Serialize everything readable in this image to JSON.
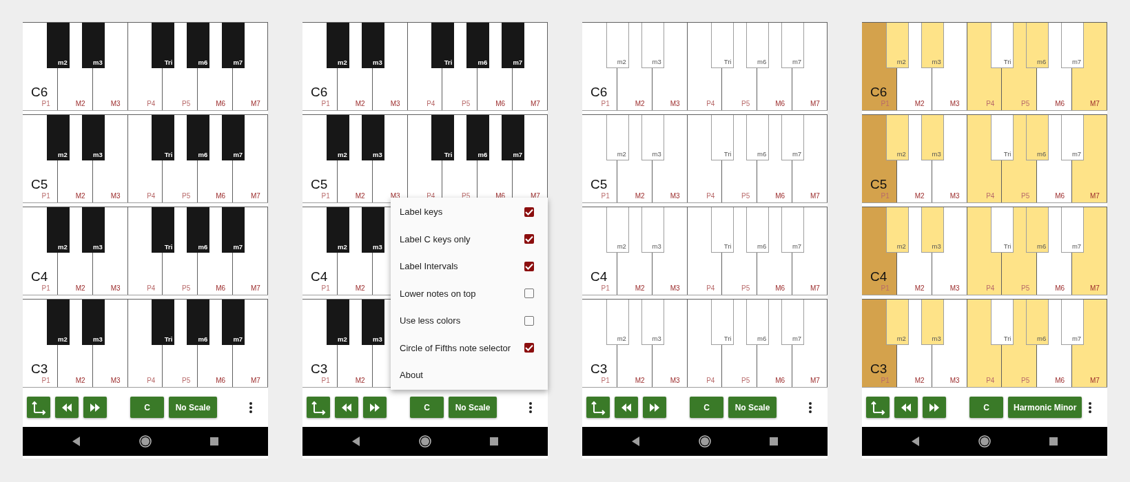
{
  "phones": [
    {
      "outlined_black_keys": false,
      "octaves": [
        {
          "label": "C6",
          "white_keys": [
            {
              "label": "P1",
              "kind": "perfect",
              "root": false,
              "in_scale": false
            },
            {
              "label": "M2",
              "kind": "major",
              "root": false,
              "in_scale": false
            },
            {
              "label": "M3",
              "kind": "major",
              "root": false,
              "in_scale": false
            },
            {
              "label": "P4",
              "kind": "perfect",
              "root": false,
              "in_scale": false
            },
            {
              "label": "P5",
              "kind": "perfect",
              "root": false,
              "in_scale": false
            },
            {
              "label": "M6",
              "kind": "major",
              "root": false,
              "in_scale": false
            },
            {
              "label": "M7",
              "kind": "major",
              "root": false,
              "in_scale": false
            }
          ],
          "black_keys": [
            {
              "label": "m2",
              "in_scale": false
            },
            {
              "label": "m3",
              "in_scale": false
            },
            {
              "label": "Tri",
              "in_scale": false
            },
            {
              "label": "m6",
              "in_scale": false
            },
            {
              "label": "m7",
              "in_scale": false
            }
          ]
        },
        {
          "label": "C5",
          "white_keys": [
            {
              "label": "P1",
              "kind": "perfect",
              "root": false,
              "in_scale": false
            },
            {
              "label": "M2",
              "kind": "major",
              "root": false,
              "in_scale": false
            },
            {
              "label": "M3",
              "kind": "major",
              "root": false,
              "in_scale": false
            },
            {
              "label": "P4",
              "kind": "perfect",
              "root": false,
              "in_scale": false
            },
            {
              "label": "P5",
              "kind": "perfect",
              "root": false,
              "in_scale": false
            },
            {
              "label": "M6",
              "kind": "major",
              "root": false,
              "in_scale": false
            },
            {
              "label": "M7",
              "kind": "major",
              "root": false,
              "in_scale": false
            }
          ],
          "black_keys": [
            {
              "label": "m2",
              "in_scale": false
            },
            {
              "label": "m3",
              "in_scale": false
            },
            {
              "label": "Tri",
              "in_scale": false
            },
            {
              "label": "m6",
              "in_scale": false
            },
            {
              "label": "m7",
              "in_scale": false
            }
          ]
        },
        {
          "label": "C4",
          "white_keys": [
            {
              "label": "P1",
              "kind": "perfect",
              "root": false,
              "in_scale": false
            },
            {
              "label": "M2",
              "kind": "major",
              "root": false,
              "in_scale": false
            },
            {
              "label": "M3",
              "kind": "major",
              "root": false,
              "in_scale": false
            },
            {
              "label": "P4",
              "kind": "perfect",
              "root": false,
              "in_scale": false
            },
            {
              "label": "P5",
              "kind": "perfect",
              "root": false,
              "in_scale": false
            },
            {
              "label": "M6",
              "kind": "major",
              "root": false,
              "in_scale": false
            },
            {
              "label": "M7",
              "kind": "major",
              "root": false,
              "in_scale": false
            }
          ],
          "black_keys": [
            {
              "label": "m2",
              "in_scale": false
            },
            {
              "label": "m3",
              "in_scale": false
            },
            {
              "label": "Tri",
              "in_scale": false
            },
            {
              "label": "m6",
              "in_scale": false
            },
            {
              "label": "m7",
              "in_scale": false
            }
          ]
        },
        {
          "label": "C3",
          "white_keys": [
            {
              "label": "P1",
              "kind": "perfect",
              "root": false,
              "in_scale": false
            },
            {
              "label": "M2",
              "kind": "major",
              "root": false,
              "in_scale": false
            },
            {
              "label": "M3",
              "kind": "major",
              "root": false,
              "in_scale": false
            },
            {
              "label": "P4",
              "kind": "perfect",
              "root": false,
              "in_scale": false
            },
            {
              "label": "P5",
              "kind": "perfect",
              "root": false,
              "in_scale": false
            },
            {
              "label": "M6",
              "kind": "major",
              "root": false,
              "in_scale": false
            },
            {
              "label": "M7",
              "kind": "major",
              "root": false,
              "in_scale": false
            }
          ],
          "black_keys": [
            {
              "label": "m2",
              "in_scale": false
            },
            {
              "label": "m3",
              "in_scale": false
            },
            {
              "label": "Tri",
              "in_scale": false
            },
            {
              "label": "m6",
              "in_scale": false
            },
            {
              "label": "m7",
              "in_scale": false
            }
          ]
        }
      ],
      "toolbar": {
        "key_button": "C",
        "scale_button": "No Scale"
      }
    },
    {
      "outlined_black_keys": false,
      "octaves": [
        {
          "label": "C6",
          "white_keys": [
            {
              "label": "P1",
              "kind": "perfect",
              "root": false,
              "in_scale": false
            },
            {
              "label": "M2",
              "kind": "major",
              "root": false,
              "in_scale": false
            },
            {
              "label": "M3",
              "kind": "major",
              "root": false,
              "in_scale": false
            },
            {
              "label": "P4",
              "kind": "perfect",
              "root": false,
              "in_scale": false
            },
            {
              "label": "P5",
              "kind": "perfect",
              "root": false,
              "in_scale": false
            },
            {
              "label": "M6",
              "kind": "major",
              "root": false,
              "in_scale": false
            },
            {
              "label": "M7",
              "kind": "major",
              "root": false,
              "in_scale": false
            }
          ],
          "black_keys": [
            {
              "label": "m2",
              "in_scale": false
            },
            {
              "label": "m3",
              "in_scale": false
            },
            {
              "label": "Tri",
              "in_scale": false
            },
            {
              "label": "m6",
              "in_scale": false
            },
            {
              "label": "m7",
              "in_scale": false
            }
          ]
        },
        {
          "label": "C5",
          "white_keys": [
            {
              "label": "P1",
              "kind": "perfect",
              "root": false,
              "in_scale": false
            },
            {
              "label": "M2",
              "kind": "major",
              "root": false,
              "in_scale": false
            },
            {
              "label": "M3",
              "kind": "major",
              "root": false,
              "in_scale": false
            },
            {
              "label": "P4",
              "kind": "perfect",
              "root": false,
              "in_scale": false
            },
            {
              "label": "P5",
              "kind": "perfect",
              "root": false,
              "in_scale": false
            },
            {
              "label": "M6",
              "kind": "major",
              "root": false,
              "in_scale": false
            },
            {
              "label": "M7",
              "kind": "major",
              "root": false,
              "in_scale": false
            }
          ],
          "black_keys": [
            {
              "label": "m2",
              "in_scale": false
            },
            {
              "label": "m3",
              "in_scale": false
            },
            {
              "label": "Tri",
              "in_scale": false
            },
            {
              "label": "m6",
              "in_scale": false
            },
            {
              "label": "m7",
              "in_scale": false
            }
          ]
        },
        {
          "label": "C4",
          "white_keys": [
            {
              "label": "P1",
              "kind": "perfect",
              "root": false,
              "in_scale": false
            },
            {
              "label": "M2",
              "kind": "major",
              "root": false,
              "in_scale": false
            }
          ],
          "black_keys": [
            {
              "label": "m2",
              "in_scale": false
            },
            {
              "label": "m3",
              "in_scale": false
            }
          ]
        },
        {
          "label": "C3",
          "white_keys": [
            {
              "label": "P1",
              "kind": "perfect",
              "root": false,
              "in_scale": false
            },
            {
              "label": "M2",
              "kind": "major",
              "root": false,
              "in_scale": false
            }
          ],
          "black_keys": [
            {
              "label": "m2",
              "in_scale": false
            },
            {
              "label": "m3",
              "in_scale": false
            }
          ]
        }
      ],
      "toolbar": {
        "key_button": "C",
        "scale_button": "No Scale"
      },
      "menu": {
        "items": [
          {
            "kind": "checkbox",
            "label": "Label keys",
            "checked": true
          },
          {
            "kind": "checkbox",
            "label": "Label C keys only",
            "checked": true
          },
          {
            "kind": "checkbox",
            "label": "Label Intervals",
            "checked": true
          },
          {
            "kind": "checkbox",
            "label": "Lower notes on top",
            "checked": false
          },
          {
            "kind": "checkbox",
            "label": "Use less colors",
            "checked": false
          },
          {
            "kind": "checkbox",
            "label": "Circle of Fifths note selector",
            "checked": true
          },
          {
            "kind": "action",
            "label": "About"
          }
        ]
      }
    },
    {
      "outlined_black_keys": true,
      "octaves": [
        {
          "label": "C6",
          "white_keys": [
            {
              "label": "P1",
              "kind": "perfect",
              "root": false,
              "in_scale": false
            },
            {
              "label": "M2",
              "kind": "major",
              "root": false,
              "in_scale": false
            },
            {
              "label": "M3",
              "kind": "major",
              "root": false,
              "in_scale": false
            },
            {
              "label": "P4",
              "kind": "perfect",
              "root": false,
              "in_scale": false
            },
            {
              "label": "P5",
              "kind": "perfect",
              "root": false,
              "in_scale": false
            },
            {
              "label": "M6",
              "kind": "major",
              "root": false,
              "in_scale": false
            },
            {
              "label": "M7",
              "kind": "major",
              "root": false,
              "in_scale": false
            }
          ],
          "black_keys": [
            {
              "label": "m2",
              "in_scale": false
            },
            {
              "label": "m3",
              "in_scale": false
            },
            {
              "label": "Tri",
              "in_scale": false
            },
            {
              "label": "m6",
              "in_scale": false
            },
            {
              "label": "m7",
              "in_scale": false
            }
          ]
        },
        {
          "label": "C5",
          "white_keys": [
            {
              "label": "P1",
              "kind": "perfect",
              "root": false,
              "in_scale": false
            },
            {
              "label": "M2",
              "kind": "major",
              "root": false,
              "in_scale": false
            },
            {
              "label": "M3",
              "kind": "major",
              "root": false,
              "in_scale": false
            },
            {
              "label": "P4",
              "kind": "perfect",
              "root": false,
              "in_scale": false
            },
            {
              "label": "P5",
              "kind": "perfect",
              "root": false,
              "in_scale": false
            },
            {
              "label": "M6",
              "kind": "major",
              "root": false,
              "in_scale": false
            },
            {
              "label": "M7",
              "kind": "major",
              "root": false,
              "in_scale": false
            }
          ],
          "black_keys": [
            {
              "label": "m2",
              "in_scale": false
            },
            {
              "label": "m3",
              "in_scale": false
            },
            {
              "label": "Tri",
              "in_scale": false
            },
            {
              "label": "m6",
              "in_scale": false
            },
            {
              "label": "m7",
              "in_scale": false
            }
          ]
        },
        {
          "label": "C4",
          "white_keys": [
            {
              "label": "P1",
              "kind": "perfect",
              "root": false,
              "in_scale": false
            },
            {
              "label": "M2",
              "kind": "major",
              "root": false,
              "in_scale": false
            },
            {
              "label": "M3",
              "kind": "major",
              "root": false,
              "in_scale": false
            },
            {
              "label": "P4",
              "kind": "perfect",
              "root": false,
              "in_scale": false
            },
            {
              "label": "P5",
              "kind": "perfect",
              "root": false,
              "in_scale": false
            },
            {
              "label": "M6",
              "kind": "major",
              "root": false,
              "in_scale": false
            },
            {
              "label": "M7",
              "kind": "major",
              "root": false,
              "in_scale": false
            }
          ],
          "black_keys": [
            {
              "label": "m2",
              "in_scale": false
            },
            {
              "label": "m3",
              "in_scale": false
            },
            {
              "label": "Tri",
              "in_scale": false
            },
            {
              "label": "m6",
              "in_scale": false
            },
            {
              "label": "m7",
              "in_scale": false
            }
          ]
        },
        {
          "label": "C3",
          "white_keys": [
            {
              "label": "P1",
              "kind": "perfect",
              "root": false,
              "in_scale": false
            },
            {
              "label": "M2",
              "kind": "major",
              "root": false,
              "in_scale": false
            },
            {
              "label": "M3",
              "kind": "major",
              "root": false,
              "in_scale": false
            },
            {
              "label": "P4",
              "kind": "perfect",
              "root": false,
              "in_scale": false
            },
            {
              "label": "P5",
              "kind": "perfect",
              "root": false,
              "in_scale": false
            },
            {
              "label": "M6",
              "kind": "major",
              "root": false,
              "in_scale": false
            },
            {
              "label": "M7",
              "kind": "major",
              "root": false,
              "in_scale": false
            }
          ],
          "black_keys": [
            {
              "label": "m2",
              "in_scale": false
            },
            {
              "label": "m3",
              "in_scale": false
            },
            {
              "label": "Tri",
              "in_scale": false
            },
            {
              "label": "m6",
              "in_scale": false
            },
            {
              "label": "m7",
              "in_scale": false
            }
          ]
        }
      ],
      "toolbar": {
        "key_button": "C",
        "scale_button": "No Scale"
      }
    },
    {
      "outlined_black_keys": true,
      "octaves": [
        {
          "label": "C6",
          "white_keys": [
            {
              "label": "P1",
              "kind": "perfect",
              "root": true,
              "in_scale": true
            },
            {
              "label": "M2",
              "kind": "major",
              "root": false,
              "in_scale": false
            },
            {
              "label": "M3",
              "kind": "major",
              "root": false,
              "in_scale": false
            },
            {
              "label": "P4",
              "kind": "perfect",
              "root": false,
              "in_scale": true
            },
            {
              "label": "P5",
              "kind": "perfect",
              "root": false,
              "in_scale": true
            },
            {
              "label": "M6",
              "kind": "major",
              "root": false,
              "in_scale": false
            },
            {
              "label": "M7",
              "kind": "major",
              "root": false,
              "in_scale": true
            }
          ],
          "black_keys": [
            {
              "label": "m2",
              "in_scale": true
            },
            {
              "label": "m3",
              "in_scale": true
            },
            {
              "label": "Tri",
              "in_scale": false
            },
            {
              "label": "m6",
              "in_scale": true
            },
            {
              "label": "m7",
              "in_scale": false
            }
          ]
        },
        {
          "label": "C5",
          "white_keys": [
            {
              "label": "P1",
              "kind": "perfect",
              "root": true,
              "in_scale": true
            },
            {
              "label": "M2",
              "kind": "major",
              "root": false,
              "in_scale": false
            },
            {
              "label": "M3",
              "kind": "major",
              "root": false,
              "in_scale": false
            },
            {
              "label": "P4",
              "kind": "perfect",
              "root": false,
              "in_scale": true
            },
            {
              "label": "P5",
              "kind": "perfect",
              "root": false,
              "in_scale": true
            },
            {
              "label": "M6",
              "kind": "major",
              "root": false,
              "in_scale": false
            },
            {
              "label": "M7",
              "kind": "major",
              "root": false,
              "in_scale": true
            }
          ],
          "black_keys": [
            {
              "label": "m2",
              "in_scale": true
            },
            {
              "label": "m3",
              "in_scale": true
            },
            {
              "label": "Tri",
              "in_scale": false
            },
            {
              "label": "m6",
              "in_scale": true
            },
            {
              "label": "m7",
              "in_scale": false
            }
          ]
        },
        {
          "label": "C4",
          "white_keys": [
            {
              "label": "P1",
              "kind": "perfect",
              "root": true,
              "in_scale": true
            },
            {
              "label": "M2",
              "kind": "major",
              "root": false,
              "in_scale": false
            },
            {
              "label": "M3",
              "kind": "major",
              "root": false,
              "in_scale": false
            },
            {
              "label": "P4",
              "kind": "perfect",
              "root": false,
              "in_scale": true
            },
            {
              "label": "P5",
              "kind": "perfect",
              "root": false,
              "in_scale": true
            },
            {
              "label": "M6",
              "kind": "major",
              "root": false,
              "in_scale": false
            },
            {
              "label": "M7",
              "kind": "major",
              "root": false,
              "in_scale": true
            }
          ],
          "black_keys": [
            {
              "label": "m2",
              "in_scale": true
            },
            {
              "label": "m3",
              "in_scale": true
            },
            {
              "label": "Tri",
              "in_scale": false
            },
            {
              "label": "m6",
              "in_scale": true
            },
            {
              "label": "m7",
              "in_scale": false
            }
          ]
        },
        {
          "label": "C3",
          "white_keys": [
            {
              "label": "P1",
              "kind": "perfect",
              "root": true,
              "in_scale": true
            },
            {
              "label": "M2",
              "kind": "major",
              "root": false,
              "in_scale": false
            },
            {
              "label": "M3",
              "kind": "major",
              "root": false,
              "in_scale": false
            },
            {
              "label": "P4",
              "kind": "perfect",
              "root": false,
              "in_scale": true
            },
            {
              "label": "P5",
              "kind": "perfect",
              "root": false,
              "in_scale": true
            },
            {
              "label": "M6",
              "kind": "major",
              "root": false,
              "in_scale": false
            },
            {
              "label": "M7",
              "kind": "major",
              "root": false,
              "in_scale": true
            }
          ],
          "black_keys": [
            {
              "label": "m2",
              "in_scale": true
            },
            {
              "label": "m3",
              "in_scale": true
            },
            {
              "label": "Tri",
              "in_scale": false
            },
            {
              "label": "m6",
              "in_scale": true
            },
            {
              "label": "m7",
              "in_scale": false
            }
          ]
        }
      ],
      "toolbar": {
        "key_button": "C",
        "scale_button": "Harmonic Minor"
      }
    }
  ]
}
